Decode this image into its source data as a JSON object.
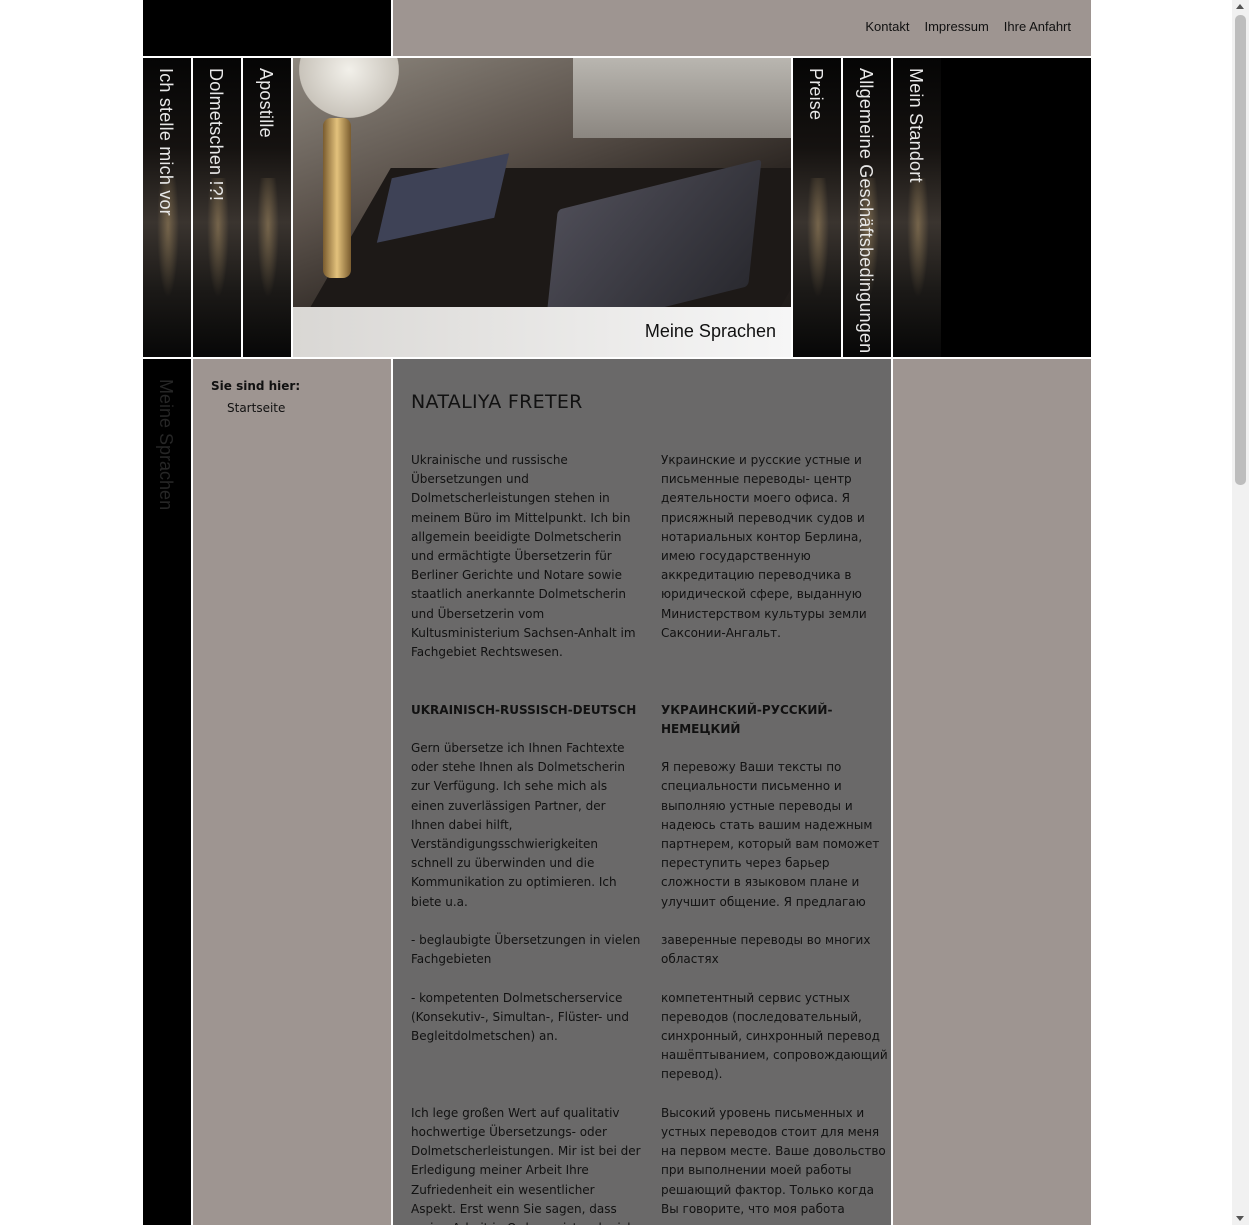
{
  "topnav": {
    "links": [
      "Kontakt",
      "Impressum",
      "Ihre Anfahrt"
    ]
  },
  "leftnav": [
    "Ich stelle mich vor",
    "Dolmetschen !?!",
    "Apostille"
  ],
  "rightnav": [
    "Preise",
    "Allgemeine Geschäftsbedingungen",
    "Mein Standort"
  ],
  "hero": {
    "caption": "Meine Sprachen"
  },
  "leftstrip_ghost": "Meine Sprachen",
  "breadcrumb": {
    "label": "Sie sind hier:",
    "item": "Startseite"
  },
  "content": {
    "title": "NATALIYA FRETER",
    "de": {
      "intro": "Ukrainische und russische Übersetzungen und Dolmetscherleistungen stehen in meinem Büro im Mittelpunkt. Ich bin allgemein beeidigte Dolmetscherin und ermächtigte Übersetzerin für Berliner Gerichte und Notare sowie staatlich anerkannte Dolmetscherin und Übersetzerin vom Kultusministerium Sachsen-Anhalt im Fachgebiet Rechtswesen.",
      "heading": "UKRAINISCH-RUSSISCH-DEUTSCH",
      "p1": "Gern übersetze ich Ihnen Fachtexte oder stehe Ihnen als Dolmetscherin zur Verfügung. Ich sehe mich als einen zuverlässigen Partner, der Ihnen dabei hilft, Verständigungsschwierigkeiten schnell zu überwinden und die Kommunikation zu optimieren. Ich biete u.a.",
      "p2": "- beglaubigte Übersetzungen in vielen Fachgebieten",
      "p3": "- kompetenten Dolmetscherservice (Konsekutiv-, Simultan-, Flüster- und Begleitdolmetschen) an.",
      "p4": "Ich lege großen Wert auf qualitativ hochwertige Übersetzungs- oder Dolmetscherleistungen. Mir ist bei der Erledigung meiner Arbeit Ihre Zufriedenheit ein wesentlicher Aspekt. Erst wenn Sie sagen, dass meine Arbeit in Ordnung ist, sehe ich ein Projekt als abgeschlossen an."
    },
    "ru": {
      "intro": "Украинские и русские устные и письменные переводы- центр деятельности моего офиса. Я присяжный переводчик судов и нотариальных контор Берлина, имею государственную аккредитацию переводчика в юридической сфере, выданную Министерством культуры земли Саксонии-Ангальт.",
      "heading": "УКРАИНСКИЙ-РУССКИЙ-НЕМЕЦКИЙ",
      "p1": "Я перевожу Ваши тексты по специальности письменно и выполняю устные переводы и надеюсь стать вашим надежным партнерем, который вам поможет переступить через барьер сложности в языковом плане и улучшит общение. Я предлагаю",
      "p2": "заверенные переводы во многих областях",
      "p3": "компетентный сервис устных переводов (последовательный, синхронный, синхронный перевод нашёптыванием, сопровождающий перевод).",
      "p4": "Высокий уровень письменных и устных переводов стоит для меня на первом месте. Ваше довольство при выполнении моей работы решающий фактор. Только когда Вы говорите, что моя работа выполнена, я рассматриваю ее в"
    }
  }
}
